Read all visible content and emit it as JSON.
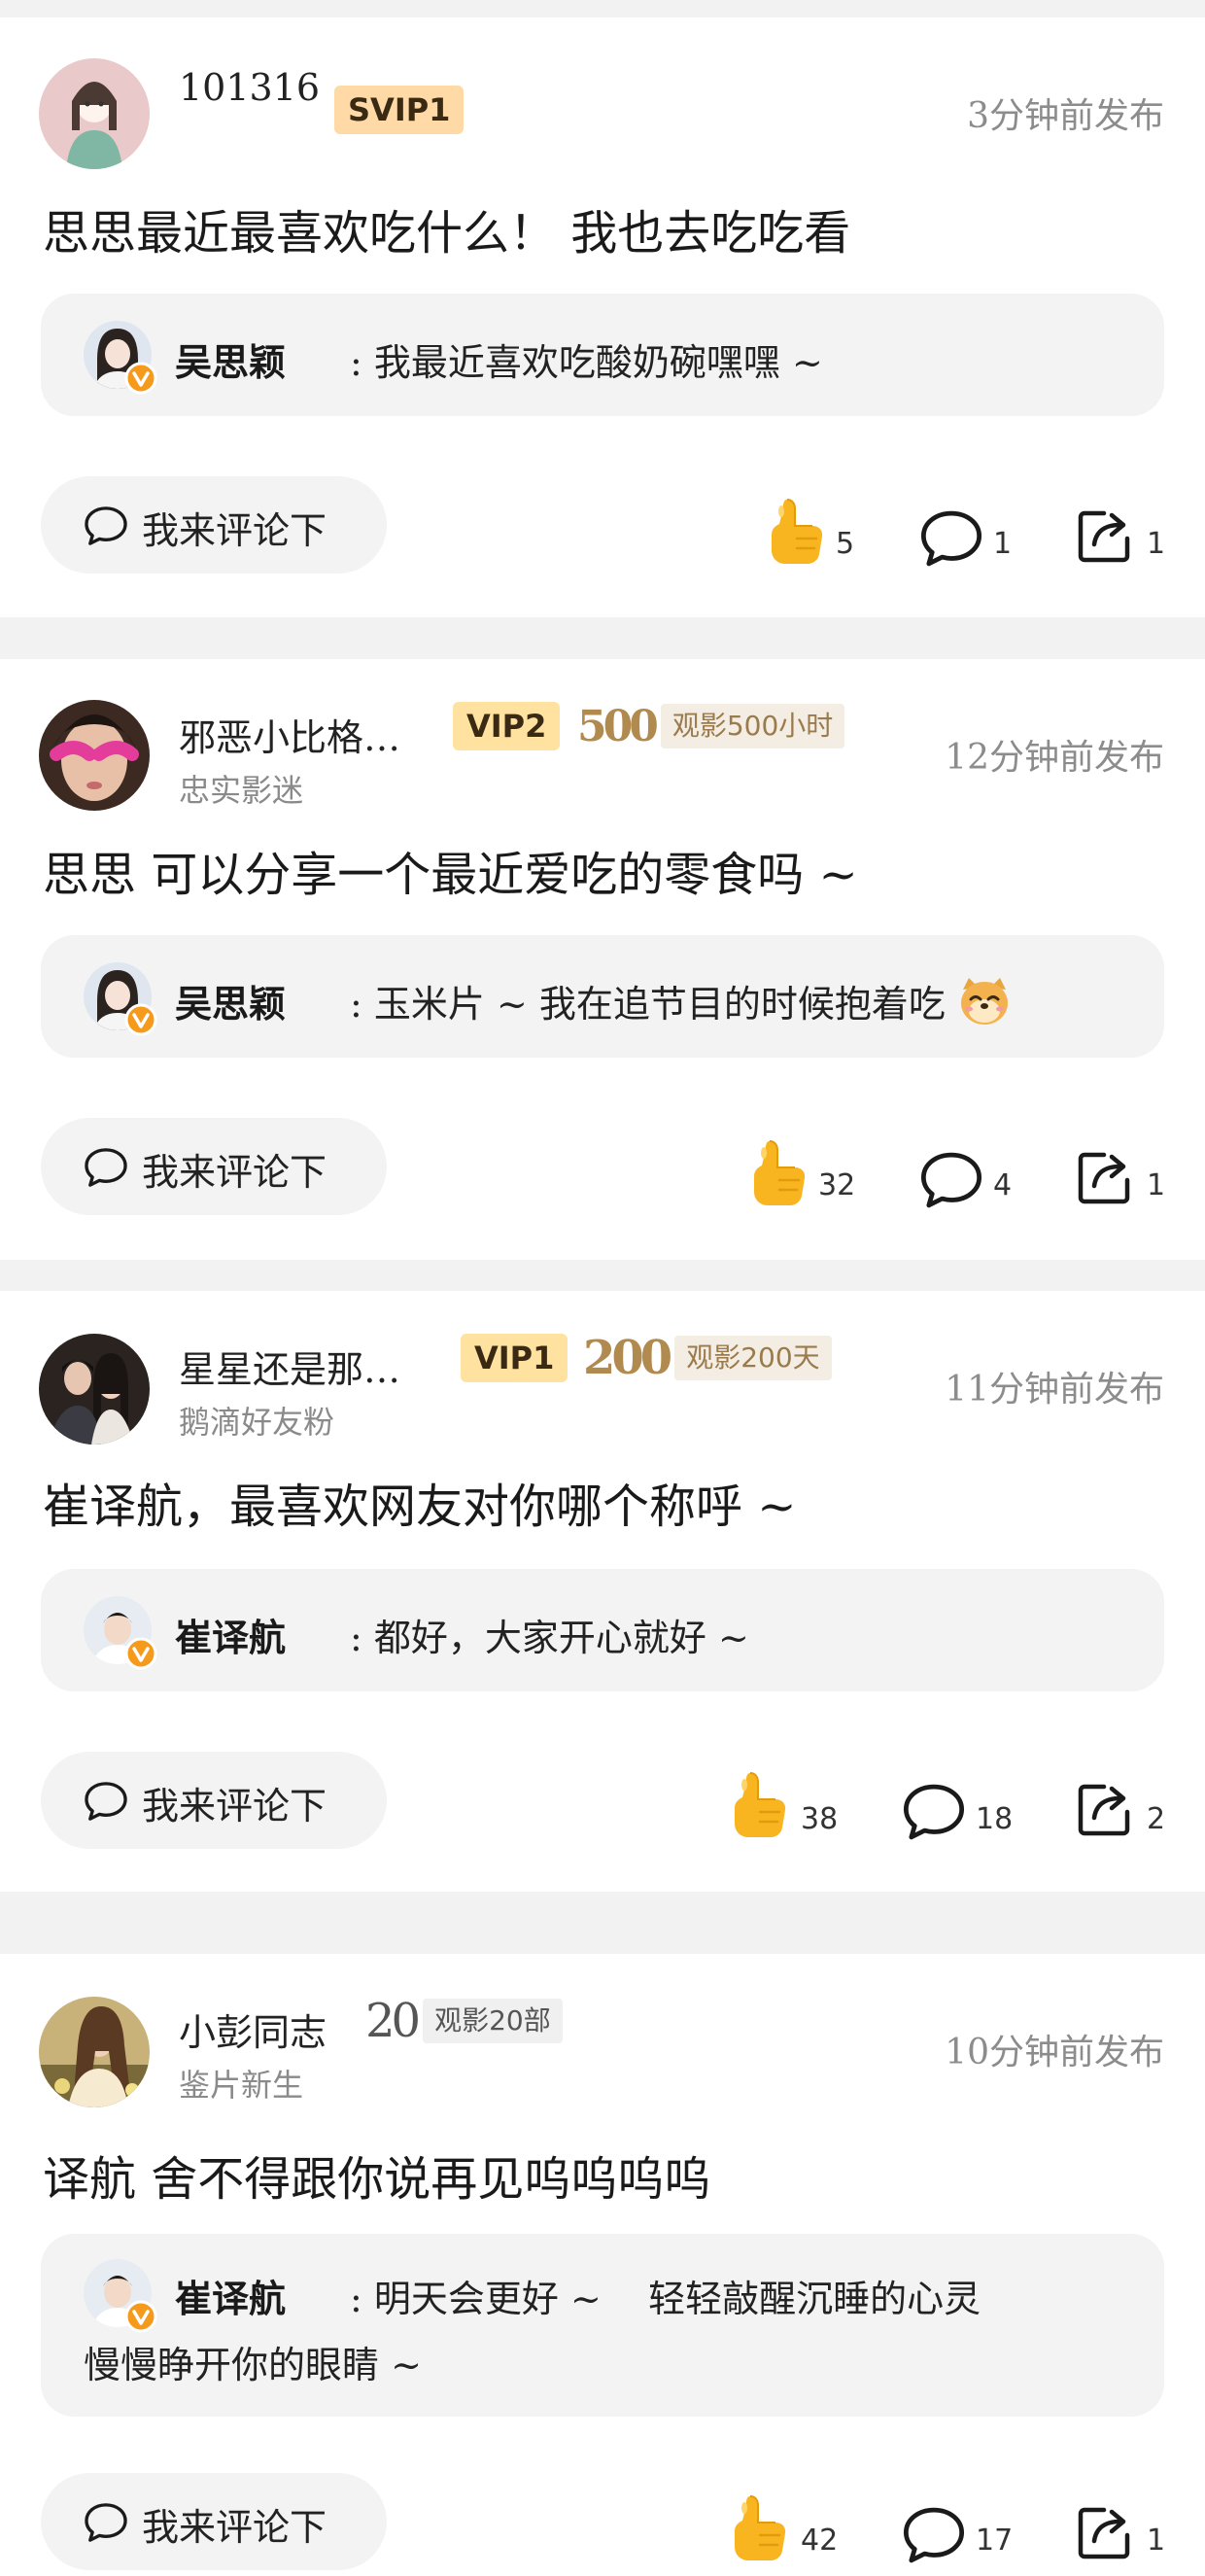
{
  "posts": [
    {
      "user_name": "101316",
      "user_title": "",
      "badge": "SVIP1",
      "watch_num": "",
      "watch_label": "",
      "time": "3分钟前发布",
      "content": "思思最近最喜欢吃什么！ 我也去吃吃看",
      "reply_name": "吴思颖",
      "reply_text": "我最近喜欢吃酸奶碗嘿嘿 ~",
      "reply_text_2": "",
      "comment_button": "我来评论下",
      "likes": "5",
      "comments": "1",
      "shares": "1"
    },
    {
      "user_name": "邪恶小比格…",
      "user_title": "忠实影迷",
      "badge": "VIP2",
      "watch_num": "500",
      "watch_label": "观影500小时",
      "time": "12分钟前发布",
      "content": "思思 可以分享一个最近爱吃的零食吗 ~",
      "reply_name": "吴思颖",
      "reply_text": "玉米片 ~ 我在追节目的时候抱着吃",
      "reply_text_2": "",
      "comment_button": "我来评论下",
      "likes": "32",
      "comments": "4",
      "shares": "1"
    },
    {
      "user_name": "星星还是那…",
      "user_title": "鹅滴好友粉",
      "badge": "VIP1",
      "watch_num": "200",
      "watch_label": "观影200天",
      "time": "11分钟前发布",
      "content": "崔译航，最喜欢网友对你哪个称呼 ~",
      "reply_name": "崔译航",
      "reply_text": "都好，大家开心就好 ~",
      "reply_text_2": "",
      "comment_button": "我来评论下",
      "likes": "38",
      "comments": "18",
      "shares": "2"
    },
    {
      "user_name": "小彭同志",
      "user_title": "鉴片新生",
      "badge": "",
      "watch_num": "20",
      "watch_label": "观影20部",
      "time": "10分钟前发布",
      "content": "译航 舍不得跟你说再见呜呜呜呜",
      "reply_name": "崔译航",
      "reply_text": "明天会更好 ~    轻轻敲醒沉睡的心灵",
      "reply_text_2": "慢慢睁开你的眼睛 ~",
      "comment_button": "我来评论下",
      "likes": "42",
      "comments": "17",
      "shares": "1"
    }
  ],
  "icons": {
    "like": "thumbs-up-emoji",
    "comment": "speech-bubble-outline",
    "share": "share-arrow-box",
    "verified": "orange-v-badge",
    "reply_emoji": "dog-face-emoji"
  },
  "colors": {
    "page_bg": "#f2f2f2",
    "card_bg": "#ffffff",
    "reply_bg": "#f3f3f3",
    "svip_badge": "#ffd9a6",
    "vip_badge": "#ffe2a0",
    "verified": "#f59a1b",
    "like_yellow": "#f8b520"
  }
}
